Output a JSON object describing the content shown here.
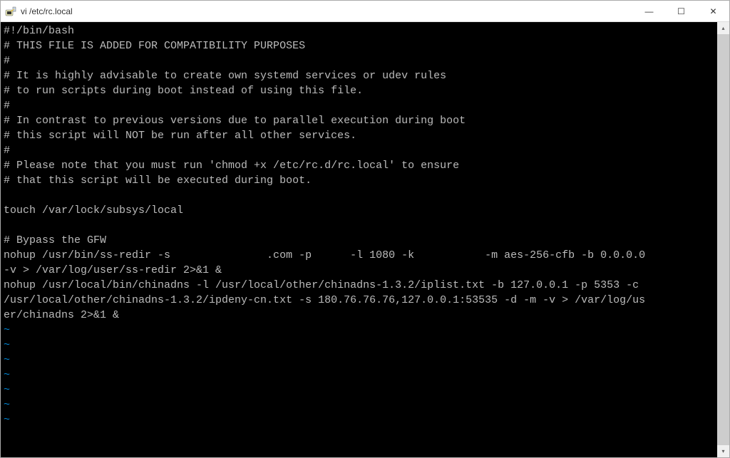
{
  "window": {
    "title": "vi /etc/rc.local"
  },
  "terminal": {
    "lines": [
      "#!/bin/bash",
      "# THIS FILE IS ADDED FOR COMPATIBILITY PURPOSES",
      "#",
      "# It is highly advisable to create own systemd services or udev rules",
      "# to run scripts during boot instead of using this file.",
      "#",
      "# In contrast to previous versions due to parallel execution during boot",
      "# this script will NOT be run after all other services.",
      "#",
      "# Please note that you must run 'chmod +x /etc/rc.d/rc.local' to ensure",
      "# that this script will be executed during boot.",
      "",
      "touch /var/lock/subsys/local",
      "",
      "# Bypass the GFW",
      "nohup /usr/bin/ss-redir -s               .com -p      -l 1080 -k           -m aes-256-cfb -b 0.0.0.0",
      "-v > /var/log/user/ss-redir 2>&1 &",
      "nohup /usr/local/bin/chinadns -l /usr/local/other/chinadns-1.3.2/iplist.txt -b 127.0.0.1 -p 5353 -c",
      "/usr/local/other/chinadns-1.3.2/ipdeny-cn.txt -s 180.76.76.76,127.0.0.1:53535 -d -m -v > /var/log/us",
      "er/chinadns 2>&1 &"
    ],
    "tilde_count": 7
  },
  "controls": {
    "minimize": "—",
    "maximize": "☐",
    "close": "✕",
    "scroll_up": "▴",
    "scroll_down": "▾"
  }
}
